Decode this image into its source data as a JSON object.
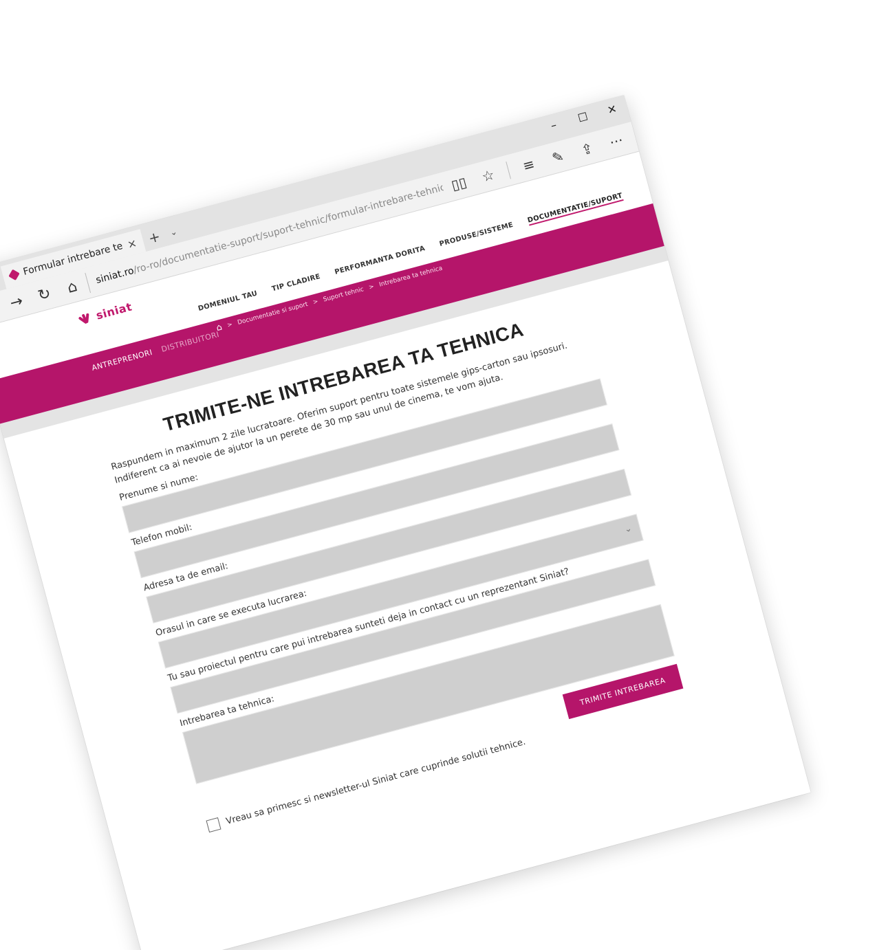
{
  "browser": {
    "tab_title": "Formular intrebare tehn",
    "tab_close": "×",
    "new_tab": "+",
    "tab_menu": "⌄",
    "window_controls": {
      "minimize": "–",
      "maximize": "☐",
      "close": "✕"
    },
    "nav": {
      "back": "←",
      "forward": "→",
      "refresh": "↻",
      "home": "⌂"
    },
    "url_host": "siniat.ro",
    "url_path": "/ro-ro/documentatie-suport/suport-tehnic/formular-intrebare-tehnica",
    "tools": {
      "reading_view": "▯▯",
      "favorite": "☆",
      "hub": "≡",
      "notes": "✎",
      "share": "⇪",
      "more": "···"
    }
  },
  "site": {
    "logo_text": "siniat",
    "nav": [
      "DOMENIUL TAU",
      "TIP CLADIRE",
      "PERFORMANTA DORITA",
      "PRODUSE/SISTEME",
      "DOCUMENTATIE/SUPORT"
    ],
    "audience_left": "ANTREPRENORI",
    "audience_right": "DISTRIBUITORI",
    "breadcrumb": [
      "Documentatie si suport",
      "Suport tehnic",
      "Intrebarea ta tehnica"
    ],
    "breadcrumb_sep": ">",
    "home_icon": "⌂"
  },
  "form": {
    "title": "TRIMITE-NE INTREBAREA TA TEHNICA",
    "intro": "Raspundem in maximum 2 zile lucratoare. Oferim suport pentru toate sistemele gips-carton sau ipsosuri. Indiferent ca ai nevoie de ajutor la un perete de 30 mp sau unul de cinema, te vom ajuta.",
    "fields": [
      {
        "label": "Prenume si nume:"
      },
      {
        "label": "Telefon mobil:"
      },
      {
        "label": "Adresa ta de email:"
      },
      {
        "label": "Orasul in care se executa lucrarea:"
      },
      {
        "label": "Tu sau proiectul pentru care pui intrebarea sunteti deja in contact cu un reprezentant Siniat?"
      },
      {
        "label": "Intrebarea ta tehnica:"
      }
    ],
    "select_chevron": "⌄",
    "consent": "Vreau sa primesc si newsletter-ul Siniat care cuprinde solutii tehnice.",
    "submit": "TRIMITE INTREBAREA"
  },
  "colors": {
    "accent": "#b5156a",
    "field_bg": "#cfcfcf"
  }
}
